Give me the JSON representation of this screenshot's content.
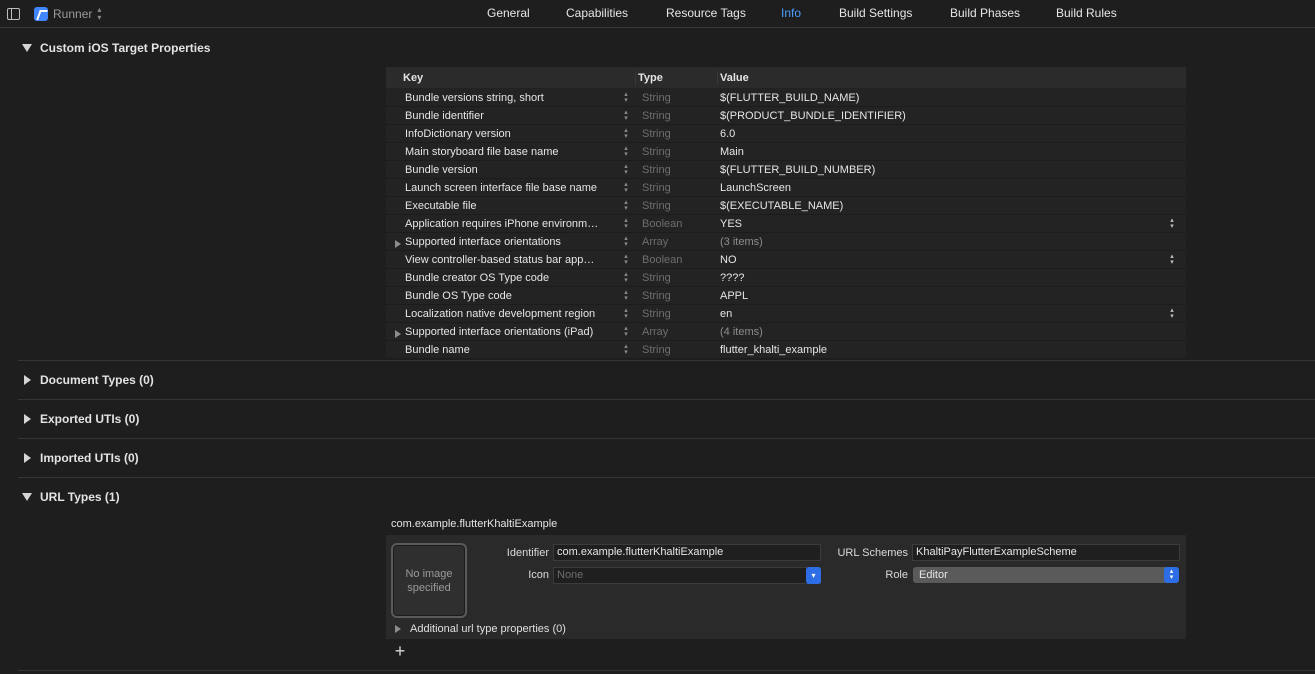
{
  "toolbar": {
    "target_name": "Runner"
  },
  "tabs": [
    {
      "label": "General"
    },
    {
      "label": "Capabilities"
    },
    {
      "label": "Resource Tags"
    },
    {
      "label": "Info"
    },
    {
      "label": "Build Settings"
    },
    {
      "label": "Build Phases"
    },
    {
      "label": "Build Rules"
    }
  ],
  "active_tab": "Info",
  "colors": {
    "accent": "#4a9dff",
    "background": "#1e1e1e",
    "select_blue": "#2d6ee6"
  },
  "sections": {
    "custom_ios": "Custom iOS Target Properties",
    "document_types": "Document Types (0)",
    "exported_utis": "Exported UTIs (0)",
    "imported_utis": "Imported UTIs (0)",
    "url_types": "URL Types (1)"
  },
  "plist": {
    "headers": {
      "key": "Key",
      "type": "Type",
      "value": "Value"
    },
    "rows": [
      {
        "key": "Bundle versions string, short",
        "type": "String",
        "value": "$(FLUTTER_BUILD_NAME)"
      },
      {
        "key": "Bundle identifier",
        "type": "String",
        "value": "$(PRODUCT_BUNDLE_IDENTIFIER)"
      },
      {
        "key": "InfoDictionary version",
        "type": "String",
        "value": "6.0"
      },
      {
        "key": "Main storyboard file base name",
        "type": "String",
        "value": "Main"
      },
      {
        "key": "Bundle version",
        "type": "String",
        "value": "$(FLUTTER_BUILD_NUMBER)"
      },
      {
        "key": "Launch screen interface file base name",
        "type": "String",
        "value": "LaunchScreen"
      },
      {
        "key": "Executable file",
        "type": "String",
        "value": "$(EXECUTABLE_NAME)"
      },
      {
        "key": "Application requires iPhone environm…",
        "type": "Boolean",
        "value": "YES"
      },
      {
        "key": "Supported interface orientations",
        "type": "Array",
        "value": "(3 items)"
      },
      {
        "key": "View controller-based status bar app…",
        "type": "Boolean",
        "value": "NO"
      },
      {
        "key": "Bundle creator OS Type code",
        "type": "String",
        "value": "????"
      },
      {
        "key": "Bundle OS Type code",
        "type": "String",
        "value": "APPL"
      },
      {
        "key": "Localization native development region",
        "type": "String",
        "value": "en"
      },
      {
        "key": "Supported interface orientations (iPad)",
        "type": "Array",
        "value": "(4 items)"
      },
      {
        "key": "Bundle name",
        "type": "String",
        "value": "flutter_khalti_example"
      }
    ]
  },
  "url_type": {
    "title": "com.example.flutterKhaltiExample",
    "image_placeholder": "No image specified",
    "identifier_label": "Identifier",
    "identifier_value": "com.example.flutterKhaltiExample",
    "icon_label": "Icon",
    "icon_placeholder": "None",
    "url_schemes_label": "URL Schemes",
    "url_schemes_value": "KhaltiPayFlutterExampleScheme",
    "role_label": "Role",
    "role_value": "Editor",
    "additional_props": "Additional url type properties (0)"
  }
}
